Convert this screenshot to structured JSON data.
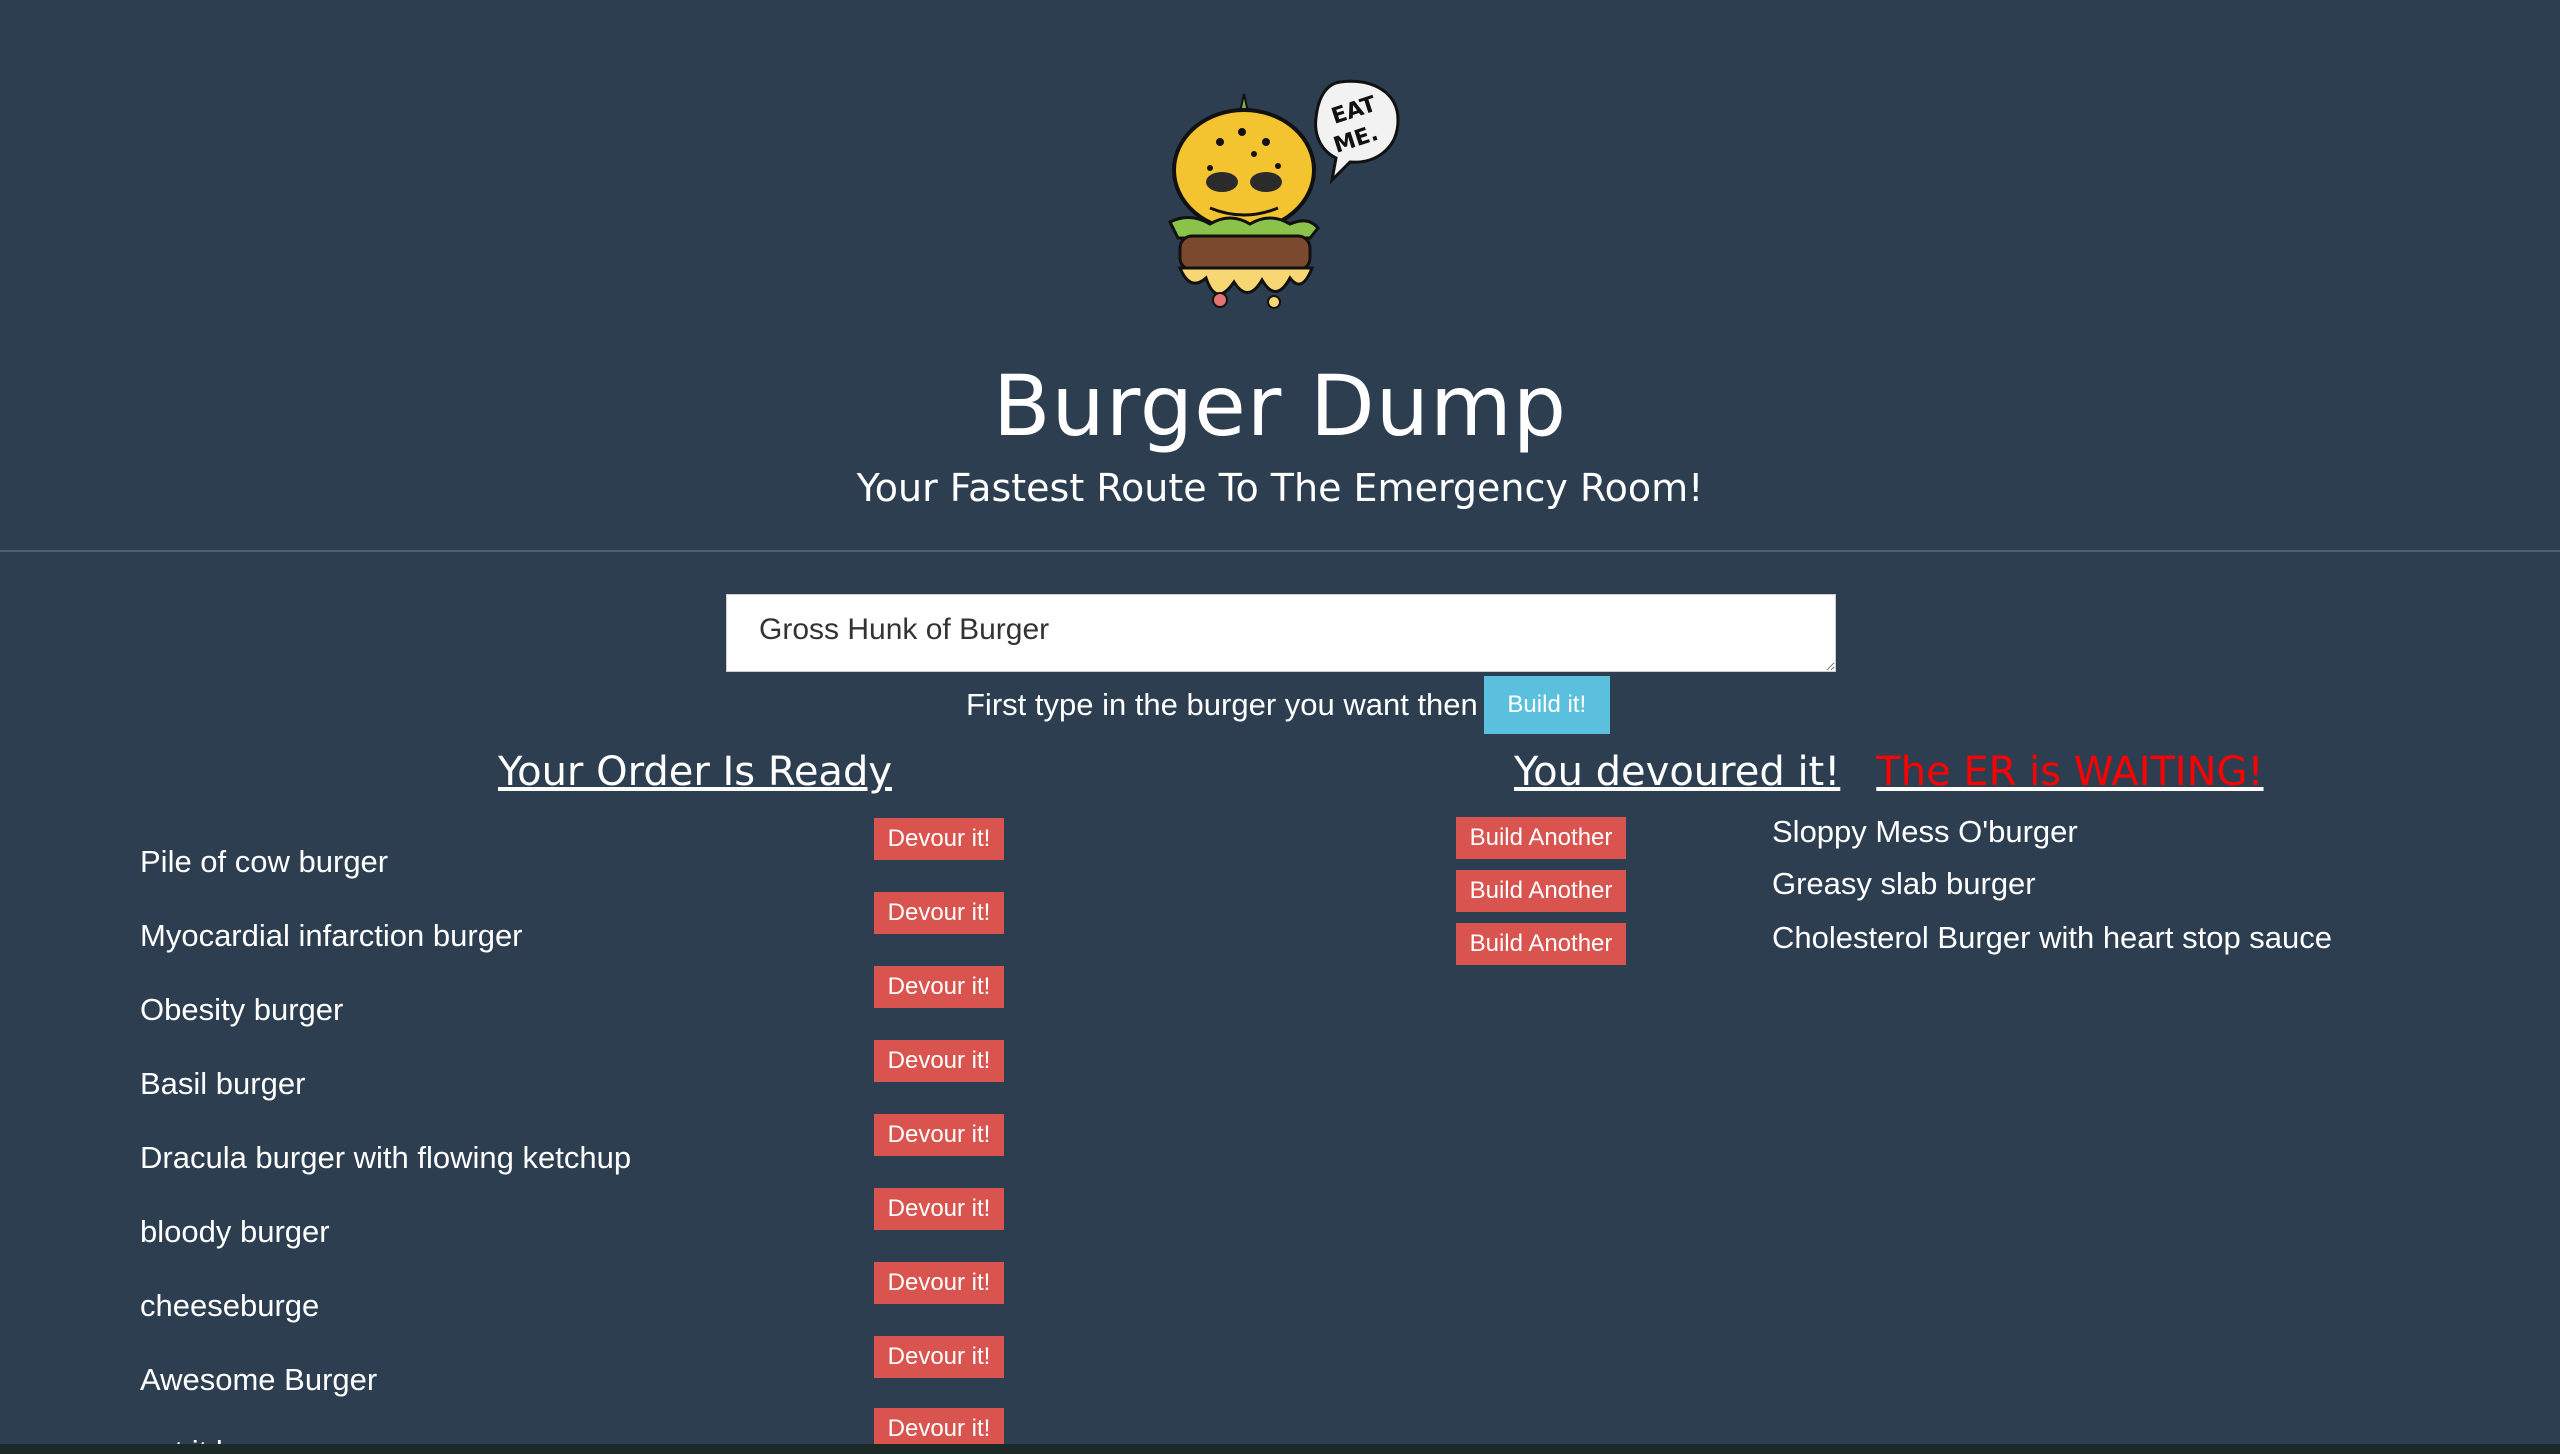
{
  "header": {
    "logo_alt": "Burger monster logo",
    "logo_speech": [
      "EAT",
      "ME."
    ],
    "title": "Burger Dump",
    "subtitle": "Your Fastest Route To The Emergency Room!"
  },
  "form": {
    "input_value": "Gross Hunk of Burger",
    "instructions": "First type in the burger you want then",
    "build_label": "Build it!"
  },
  "ready": {
    "heading": "Your Order Is Ready",
    "devour_label": "Devour it!",
    "items": [
      "Pile of cow burger",
      "Myocardial infarction burger",
      "Obesity burger",
      "Basil burger",
      "Dracula burger with flowing ketchup",
      "bloody burger",
      "cheeseburge",
      "Awesome Burger",
      "get it burger"
    ]
  },
  "devoured": {
    "heading": "You devoured it!",
    "warning": "The ER is WAITING!",
    "build_another_label": "Build Another",
    "items": [
      "Sloppy Mess O'burger",
      "Greasy slab burger",
      "Cholesterol Burger with heart stop sauce"
    ]
  },
  "colors": {
    "background": "#2c3e50",
    "danger": "#d9534f",
    "info": "#5bc0de",
    "warning_text": "#ff0000"
  }
}
